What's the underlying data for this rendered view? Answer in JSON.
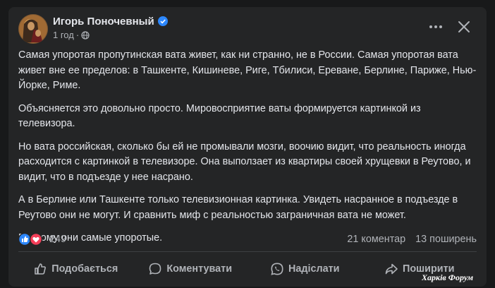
{
  "post": {
    "author": "Игорь Поночевный",
    "time": "1 год",
    "separator": "·",
    "paragraphs": [
      "Самая упоротая пропутинская вата живет, как ни странно, не в России. Самая упоротая вата живет вне ее пределов: в Ташкенте, Кишиневе, Риге, Тбилиси, Ереване, Берлине, Париже, Нью-Йорке, Риме.",
      "Объясняется это довольно просто. Мировосприятие ваты формируется картинкой из телевизора.",
      "Но вата российская, сколько бы ей не промывали мозги, воочию видит, что реальность иногда расходится с картинкой в телевизоре. Она выползает из квартиры своей хрущевки в Реутово, и видит, что в подъезде у нее насрано.",
      "А в Берлине или Ташкенте только телевизионная картинка. Увидеть насранное в подъезде в Реутово они не могут. И сравнить миф с реальностью заграничная вата не может.",
      "Поэтому они самые упоротые."
    ],
    "reactions_count": "249",
    "comments": "21 коментар",
    "shares": "13 поширень"
  },
  "actions": {
    "like": "Подобається",
    "comment": "Коментувати",
    "send": "Надіслати",
    "share": "Поширити"
  },
  "icons": {
    "verified": "verified-badge-icon",
    "globe": "globe-icon",
    "more": "more-options-icon",
    "close": "close-icon",
    "like_reaction": "like-reaction-icon",
    "love_reaction": "love-reaction-icon",
    "like": "thumbs-up-icon",
    "comment": "comment-bubble-icon",
    "send": "whatsapp-send-icon",
    "share": "share-arrow-icon"
  },
  "colors": {
    "background": "#18191a",
    "card": "#242526",
    "text_primary": "#e4e6eb",
    "text_secondary": "#b0b3b8",
    "accent_blue": "#2d88ff",
    "love_red": "#f33e58"
  },
  "watermark": "Харків Форум"
}
